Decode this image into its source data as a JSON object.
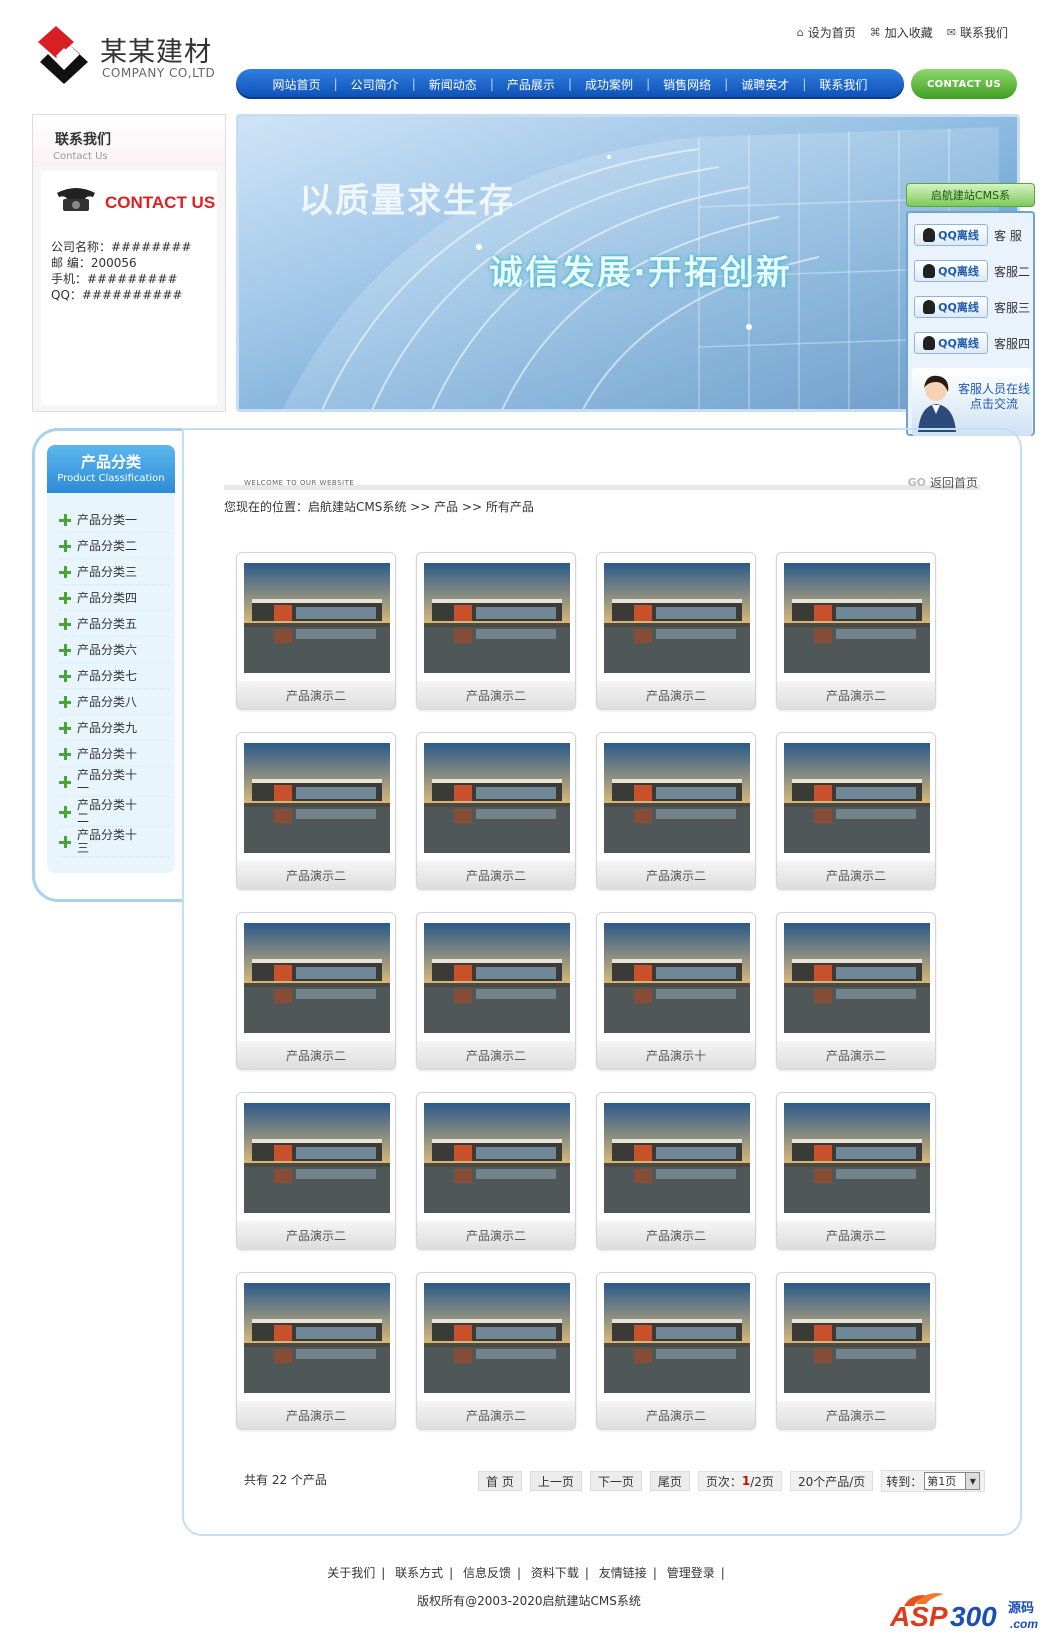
{
  "header": {
    "logo_cn": "某某建材",
    "logo_en": "COMPANY CO,LTD",
    "top_links": [
      "设为首页",
      "加入收藏",
      "联系我们"
    ],
    "nav": [
      "网站首页",
      "公司简介",
      "新闻动态",
      "产品展示",
      "成功案例",
      "销售网络",
      "诚聘英才",
      "联系我们"
    ],
    "contact_button": "CONTACT US"
  },
  "contact": {
    "title": "联系我们",
    "subtitle": "Contact Us",
    "contact_us": "CONTACT US",
    "company": "公司名称：########",
    "postcode": "邮 编：200056",
    "mobile": "手机：#########",
    "qq": "QQ：##########"
  },
  "banner": {
    "line1": "以质量求生存",
    "line2": "诚信发展·开拓创新"
  },
  "qq_float": {
    "title": "启航建站CMS系",
    "qq_label": "QQ离线",
    "agents": [
      "客 服",
      "客服二",
      "客服三",
      "客服四"
    ],
    "online_line1": "客服人员在线",
    "online_line2": "点击交流"
  },
  "sidebar": {
    "title": "产品分类",
    "subtitle": "Product Classification",
    "categories": [
      "产品分类一",
      "产品分类二",
      "产品分类三",
      "产品分类四",
      "产品分类五",
      "产品分类六",
      "产品分类七",
      "产品分类八",
      "产品分类九",
      "产品分类十",
      "产品分类十一",
      "产品分类十二",
      "产品分类十三"
    ]
  },
  "content": {
    "welcome": "WELCOME TO OUR WEBSITE",
    "go_mark": "GO",
    "back_home": "返回首页",
    "breadcrumb": "您现在的位置：启航建站CMS系统 >> 产品 >> 所有产品",
    "products": [
      "产品演示二",
      "产品演示二",
      "产品演示二",
      "产品演示二",
      "产品演示二",
      "产品演示二",
      "产品演示二",
      "产品演示二",
      "产品演示二",
      "产品演示二",
      "产品演示十",
      "产品演示二",
      "产品演示二",
      "产品演示二",
      "产品演示二",
      "产品演示二",
      "产品演示二",
      "产品演示二",
      "产品演示二",
      "产品演示二"
    ]
  },
  "pagination": {
    "total": "共有 22 个产品",
    "first": "首 页",
    "prev": "上一页",
    "next": "下一页",
    "last": "尾页",
    "page_label": "页次：",
    "page_current": "1",
    "page_total": "/2页",
    "per_page": "20个产品/页",
    "jump_label": "转到：",
    "jump_value": "第1页"
  },
  "footer": {
    "links": [
      "关于我们",
      "联系方式",
      "信息反馈",
      "资料下载",
      "友情链接",
      "管理登录"
    ],
    "copyright": "版权所有@2003-2020启航建站CMS系统",
    "watermark": "ASP300 源码 .com"
  },
  "colors": {
    "nav_blue": "#1a5fc8",
    "contact_green": "#5bb33a",
    "accent_red": "#e02020",
    "frame_blue": "#aad1ef"
  }
}
